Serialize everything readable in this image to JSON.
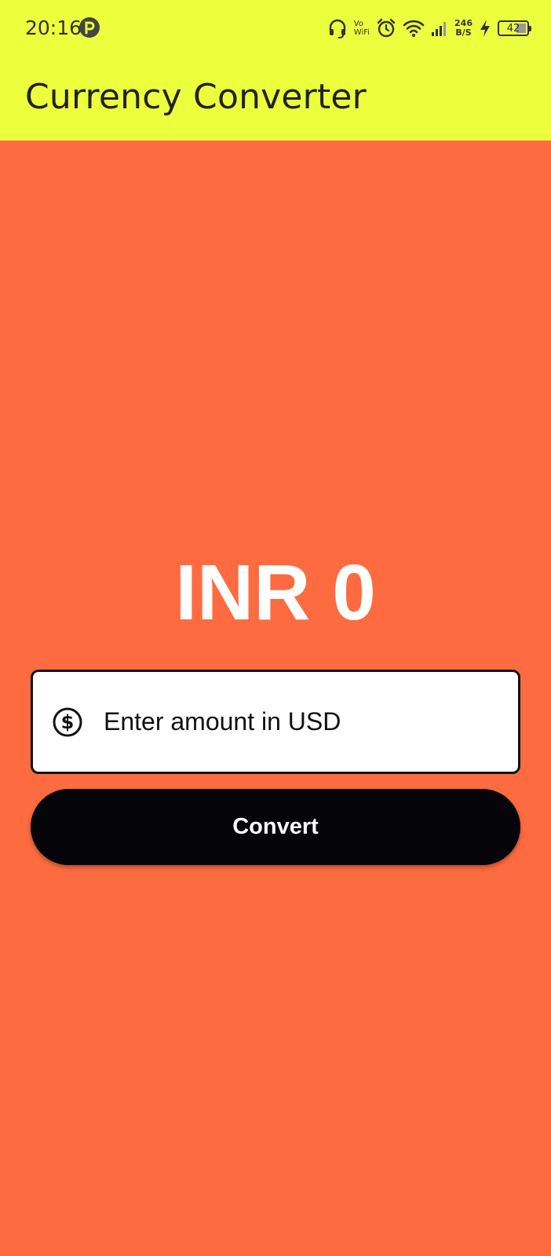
{
  "status_bar": {
    "time": "20:16",
    "vowifi_top": "Vo",
    "vowifi_bottom": "WiFi",
    "net_speed_value": "246",
    "net_speed_unit": "B/S",
    "battery_level": "42",
    "icons": [
      "app-notification-icon",
      "headset-icon",
      "vowifi-icon",
      "alarm-icon",
      "wifi-icon",
      "signal-icon",
      "charging-icon",
      "battery-icon"
    ]
  },
  "app_bar": {
    "title": "Currency Converter",
    "background_color": "#ECFF3D"
  },
  "main": {
    "background_color": "#FF6B40",
    "result_text": "INR 0",
    "input": {
      "placeholder": "Enter amount in USD",
      "value": "",
      "prefix_icon": "dollar-circle-icon"
    },
    "convert_button": {
      "label": "Convert",
      "background_color": "#050509"
    }
  }
}
